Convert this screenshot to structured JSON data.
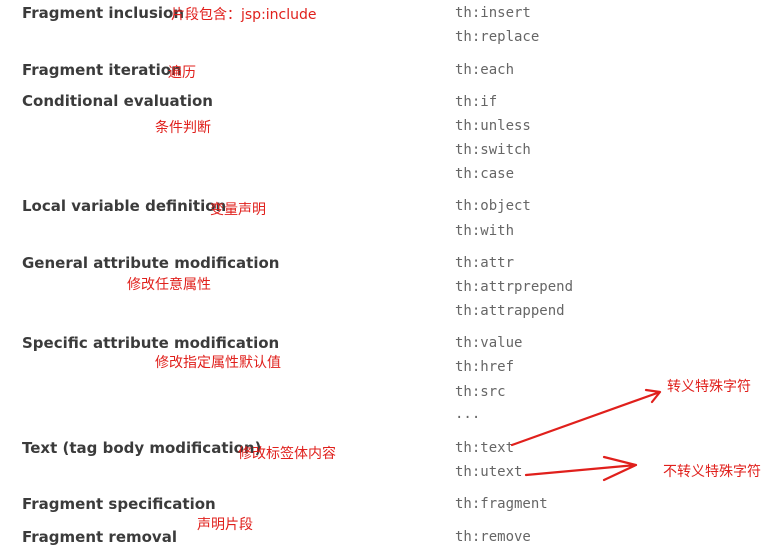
{
  "rows": [
    {
      "feature": "Fragment inclusion",
      "note": "片段包含：jsp:include",
      "attrs": [
        "th:insert",
        "th:replace"
      ]
    },
    {
      "feature": "Fragment iteration",
      "note": "遍历",
      "attrs": [
        "th:each"
      ]
    },
    {
      "feature": "Conditional evaluation",
      "note": "条件判断",
      "attrs": [
        "th:if",
        "th:unless",
        "th:switch",
        "th:case"
      ]
    },
    {
      "feature": "Local variable definition",
      "note": "变量声明",
      "attrs": [
        "th:object",
        "th:with"
      ]
    },
    {
      "feature": "General attribute modification",
      "note": "修改任意属性",
      "attrs": [
        "th:attr",
        "th:attrprepend",
        "th:attrappend"
      ]
    },
    {
      "feature": "Specific attribute modification",
      "note": "修改指定属性默认值",
      "attrs": [
        "th:value",
        "th:href",
        "th:src",
        "..."
      ]
    },
    {
      "feature": "Text (tag body modification)",
      "note": "修改标签体内容",
      "attrs": [
        "th:text",
        "th:utext"
      ]
    },
    {
      "feature": "Fragment specification",
      "note": "声明片段",
      "attrs": [
        "th:fragment"
      ]
    },
    {
      "feature": "Fragment removal",
      "note": "",
      "attrs": [
        "th:remove"
      ]
    }
  ],
  "annotations": {
    "escape": "转义特殊字符",
    "no_escape": "不转义特殊字符"
  },
  "colors": {
    "feature_text": "#3b3b3b",
    "attr_text": "#666666",
    "annotation_red": "#e0201c"
  }
}
